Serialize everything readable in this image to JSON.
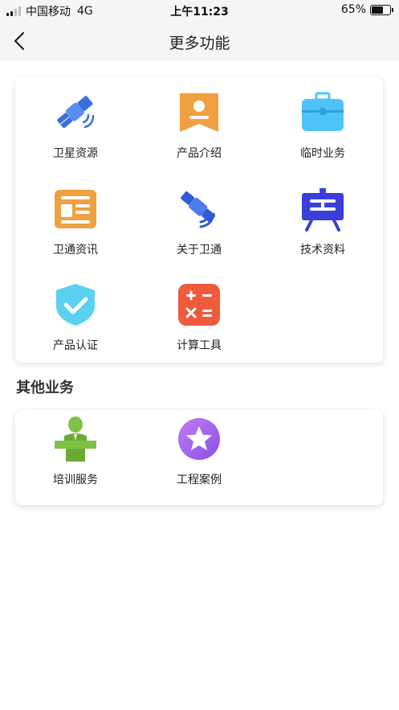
{
  "status_bar": {
    "carrier": "中国移动",
    "network": "4G",
    "time": "上午11:23",
    "battery_text": "65%",
    "battery_level": 0.65
  },
  "nav": {
    "title": "更多功能"
  },
  "main_grid": {
    "items": [
      {
        "label": "卫星资源",
        "icon": "satellite-icon"
      },
      {
        "label": "产品介绍",
        "icon": "bookmark-badge-icon"
      },
      {
        "label": "临时业务",
        "icon": "briefcase-icon"
      },
      {
        "label": "卫通资讯",
        "icon": "news-icon"
      },
      {
        "label": "关于卫通",
        "icon": "satellite-signal-icon"
      },
      {
        "label": "技术资料",
        "icon": "easel-board-icon"
      },
      {
        "label": "产品认证",
        "icon": "shield-check-icon"
      },
      {
        "label": "计算工具",
        "icon": "calculator-icon"
      }
    ]
  },
  "other_section": {
    "title": "其他业务",
    "items": [
      {
        "label": "培训服务",
        "icon": "trainer-podium-icon"
      },
      {
        "label": "工程案例",
        "icon": "star-badge-icon"
      }
    ]
  },
  "colors": {
    "blue": "#3b6fe0",
    "orange": "#f0a040",
    "cyan": "#4fc3f7",
    "red": "#ef5a3c",
    "purple": "#a86bef",
    "green": "#7cc243"
  }
}
